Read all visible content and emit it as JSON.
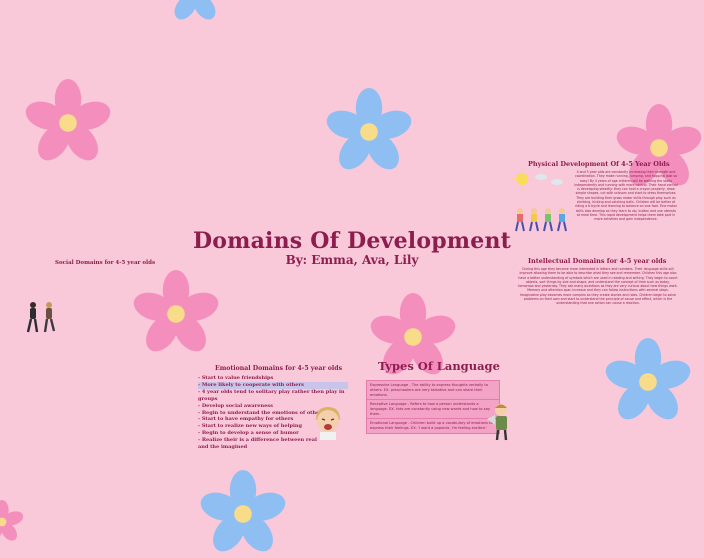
{
  "presentation": {
    "title": "Domains Of Development",
    "subtitle": "By: Emma, Ava, Lily"
  },
  "social": {
    "heading": "Social Domains for 4-5 year olds"
  },
  "physical": {
    "heading": "Physical Development Of 4-5 Year Olds",
    "body": "4 and 5 year olds are constantly increasing their strength and coordination. They make running, jumping, and hopping look so easy! By 4 years of age children will be walking the stairs independently and running with more control. Their hand control is developing steadily: they can hold a crayon properly, draw simple shapes, cut with scissors and start to dress themselves. They are building their gross motor skills through play such as climbing, kicking and catching balls. Children will be better at riding a tricycle and learning to balance on one foot. Fine motor skills also develop as they learn to zip, button and use utensils at meal time. This rapid development helps them take part in more activities and gain independence."
  },
  "intellectual": {
    "heading": "Intellectual Domains for 4-5 year olds",
    "body": "During this age they become more interested in letters and numbers. Their language skills will improve allowing them to be able to describe what they see and remember. Children this age also have a better understanding of symbols which are used in reading and writing. They begin to count objects, sort things by size and shape, and understand the concept of time such as today, tomorrow and yesterday. They ask many questions as they are very curious about how things work. Memory and attention span increase and they can follow instructions with several steps. Imaginative play becomes more complex as they create stories and roles. Children begin to solve problems on their own and start to understand the principle of cause and effect, which is the understanding that one action can cause a reaction."
  },
  "emotional": {
    "heading": "Emotional Domains for 4-5 year olds",
    "items": [
      "- Start to value friendships",
      "- More likely to cooperate with others",
      "- 4 year olds tend to solitary play rather then play in groups",
      "- Develop social awareness",
      "- Begin to understand the emotions of others",
      "- Start to have empathy for others",
      "- Start to realize new ways of helping",
      "- Begin to develop a sense of humor",
      "- Realize their is a difference between real",
      "  and the imagined"
    ]
  },
  "language": {
    "heading": "Types Of Language",
    "boxes": [
      "Expressive Language - The ability to express thoughts verbally to others. EX. preschoolers are very talkative and can share their emotions.",
      "Receptive Language - Refers to how a person understands a language. EX. kids are constantly using new words and how to say them.",
      "Emotional Language - Children build up a vocabulary of emotions to express their feelings. EX. 'I want a popsicle, I'm feeling excited.'"
    ]
  },
  "colors": {
    "background": "#f9c9d9",
    "accent": "#8c1d4e",
    "flower_pink": "#f48fbd",
    "flower_blue": "#8fbff2",
    "flower_center": "#f8dc8a",
    "highlight": "#c9c5ea",
    "box": "#f3a3c6"
  },
  "icons": [
    "flower-icon",
    "sun-icon",
    "cloud-icon",
    "kids-running-icon",
    "crying-child-icon",
    "megaphone-child-icon",
    "people-walking-icon"
  ]
}
